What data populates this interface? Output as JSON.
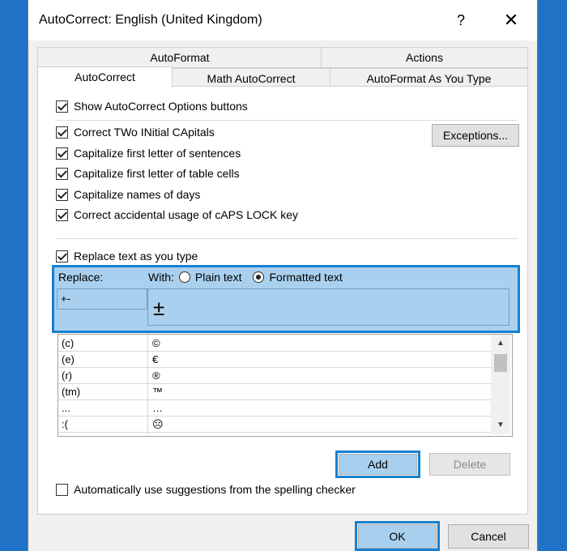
{
  "window": {
    "title": "AutoCorrect: English (United Kingdom)",
    "help": "?",
    "close": "✕"
  },
  "tabs": {
    "autoformat": "AutoFormat",
    "actions": "Actions",
    "autocorrect": "AutoCorrect",
    "math": "Math AutoCorrect",
    "autoformat_type": "AutoFormat As You Type"
  },
  "options": {
    "show_buttons": "Show AutoCorrect Options buttons",
    "two_initial": "Correct TWo INitial CApitals",
    "first_sentence": "Capitalize first letter of sentences",
    "first_table": "Capitalize first letter of table cells",
    "names_days": "Capitalize names of days",
    "caps_lock": "Correct accidental usage of cAPS LOCK key",
    "replace_text": "Replace text as you type",
    "suggestions": "Automatically use suggestions from the spelling checker"
  },
  "buttons": {
    "exceptions": "Exceptions...",
    "add": "Add",
    "delete": "Delete",
    "ok": "OK",
    "cancel": "Cancel"
  },
  "replace": {
    "replace_label": "Replace:",
    "with_label": "With:",
    "plain": "Plain text",
    "formatted": "Formatted text",
    "replace_value": "+-",
    "with_value": "±"
  },
  "entries": [
    {
      "replace": "(c)",
      "with": "©"
    },
    {
      "replace": "(e)",
      "with": "€"
    },
    {
      "replace": "(r)",
      "with": "®"
    },
    {
      "replace": "(tm)",
      "with": "™"
    },
    {
      "replace": "...",
      "with": "…"
    },
    {
      "replace": ":(",
      "with": "☹"
    }
  ],
  "colors": {
    "highlight": "#1681d2",
    "selection": "#a9d0ee",
    "desktop": "#1f72c6"
  }
}
